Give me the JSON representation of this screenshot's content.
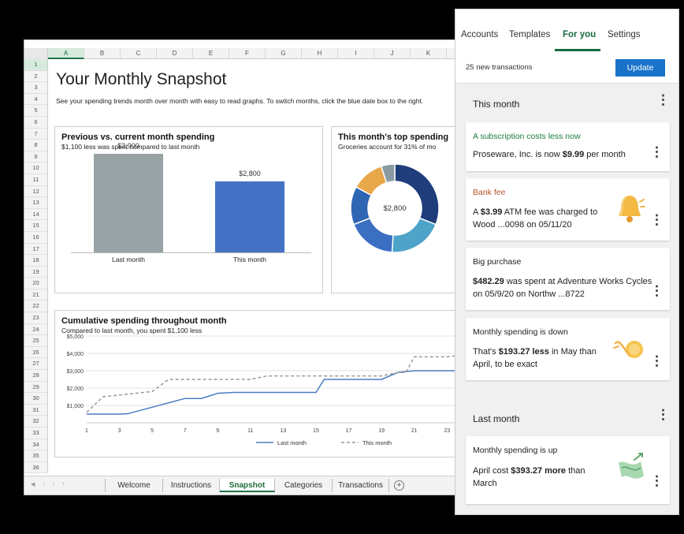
{
  "spreadsheet": {
    "columns": [
      "A",
      "B",
      "C",
      "D",
      "E",
      "F",
      "G",
      "H",
      "I",
      "J",
      "K"
    ],
    "rows": [
      "1",
      "2",
      "3",
      "4",
      "5",
      "6",
      "7",
      "8",
      "9",
      "10",
      "11",
      "12",
      "13",
      "14",
      "15",
      "16",
      "17",
      "18",
      "19",
      "20",
      "21",
      "22",
      "23",
      "24",
      "25",
      "26",
      "27",
      "28",
      "29",
      "30",
      "31",
      "32",
      "33",
      "34",
      "35",
      "36"
    ],
    "title": "Your Monthly Snapshot",
    "subtitle": "See your spending trends month over month with easy to read graphs. To switch months, click the blue date box to the right.",
    "sheet_tabs": [
      "Welcome",
      "Instructions",
      "Snapshot",
      "Categories",
      "Transactions"
    ],
    "active_tab": "Snapshot",
    "add_sheet_icon": "plus-circle-icon",
    "colors": {
      "accent": "#217346",
      "bar_last": "#98a3a5",
      "bar_this": "#4472c4"
    }
  },
  "bar_card": {
    "title": "Previous vs. current month spending",
    "subtitle": "$1,100 less was spent compared to last month"
  },
  "donut_card": {
    "title": "This month's top spending",
    "subtitle": "Groceries account for 31% of mo",
    "center_label": "$2,800"
  },
  "line_card": {
    "title": "Cumulative spending throughout month",
    "subtitle": "Compared to last month, you spent $1,100 less"
  },
  "chart_data": [
    {
      "type": "bar",
      "title": "Previous vs. current month spending",
      "categories": [
        "Last month",
        "This month"
      ],
      "values": [
        3900,
        2800
      ],
      "value_labels": [
        "$3,900",
        "$2,800"
      ],
      "colors": [
        "#98a3a5",
        "#4472c4"
      ]
    },
    {
      "type": "pie",
      "title": "This month's top spending",
      "center_label": "$2,800",
      "values": [
        31,
        20,
        18,
        14,
        12,
        5
      ],
      "colors": [
        "#1f3d7a",
        "#4ea3c8",
        "#3b6fc2",
        "#2f66b3",
        "#e8a84a",
        "#8a9aa3"
      ]
    },
    {
      "type": "line",
      "title": "Cumulative spending throughout month",
      "x_ticks": [
        "1",
        "3",
        "5",
        "7",
        "9",
        "11",
        "13",
        "15",
        "17",
        "19",
        "21",
        "23"
      ],
      "y_ticks": [
        "$1,000",
        "$2,000",
        "$3,000",
        "$4,000",
        "$5,000"
      ],
      "ylim": [
        0,
        5000
      ],
      "xlim": [
        1,
        24
      ],
      "series": [
        {
          "name": "Last month",
          "style": "solid",
          "color": "#4a7cc4",
          "x": [
            1,
            3,
            3.5,
            7,
            8,
            9,
            10,
            11,
            12,
            15,
            15.5,
            19,
            20,
            21,
            22,
            23,
            24
          ],
          "y": [
            500,
            500,
            520,
            1400,
            1400,
            1700,
            1750,
            1750,
            1750,
            1750,
            2500,
            2500,
            2900,
            3000,
            3000,
            3000,
            3000
          ]
        },
        {
          "name": "This month",
          "style": "dashed",
          "color": "#999999",
          "x": [
            1,
            2,
            3,
            5,
            6,
            9,
            10,
            11,
            12,
            19,
            20,
            20.5,
            21,
            22,
            23,
            24
          ],
          "y": [
            600,
            1500,
            1600,
            1800,
            2500,
            2500,
            2500,
            2500,
            2700,
            2700,
            2900,
            2900,
            3800,
            3800,
            3800,
            3900
          ]
        }
      ]
    }
  ],
  "pane": {
    "tabs": [
      "Accounts",
      "Templates",
      "For you",
      "Settings"
    ],
    "active_tab": "For you",
    "new_transactions": "25 new transactions",
    "update_label": "Update",
    "this_month_label": "This month",
    "last_month_label": "Last month",
    "cards": [
      {
        "title": "A subscription costs less now",
        "title_color": "#1a7a3e",
        "body": [
          "Proseware, Inc. is now ",
          "$9.99",
          " per month"
        ],
        "icon": ""
      },
      {
        "title": "Bank fee",
        "title_color": "#b4532a",
        "body": [
          "A ",
          "$3.99",
          " ATM fee was charged to Wood ...0098 on 05/11/20"
        ],
        "icon": "bell-icon"
      },
      {
        "title": "Big purchase",
        "title_color": "#222222",
        "body": [
          "",
          "$482.29",
          " was spent at Adventure Works Cycles on 05/9/20 on Northw ...8722"
        ],
        "icon": ""
      },
      {
        "title": "Monthly spending is down",
        "title_color": "#222222",
        "body": [
          "That's ",
          "$193.27 less",
          " in May than April, to be exact"
        ],
        "icon": "coin-down-icon"
      },
      {
        "title": "Monthly spending is up",
        "title_color": "#222222",
        "body": [
          "April cost ",
          "$393.27 more",
          " than March"
        ],
        "icon": "money-up-icon"
      }
    ]
  }
}
